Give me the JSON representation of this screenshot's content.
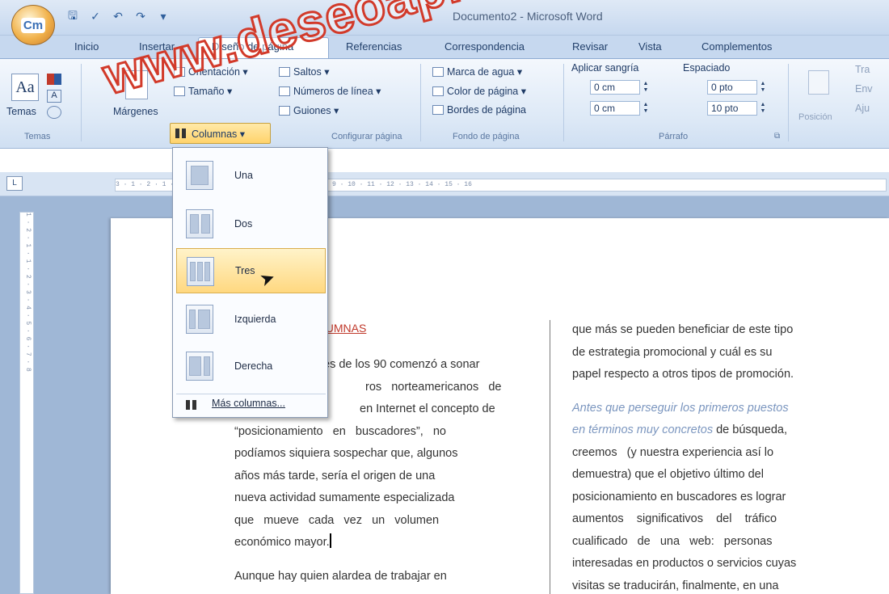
{
  "window": {
    "title": "Documento2 - Microsoft Word"
  },
  "office_button": {
    "label": "Cm"
  },
  "quick_access": [
    "save-icon",
    "spelling-icon",
    "undo-icon",
    "redo-icon",
    "customize-icon"
  ],
  "tabs": [
    "Inicio",
    "Insertar",
    "Diseño de página",
    "Referencias",
    "Correspondencia",
    "Revisar",
    "Vista",
    "Complementos"
  ],
  "active_tab": "Diseño de página",
  "ribbon": {
    "temas": {
      "button": "Temas",
      "group": "Temas"
    },
    "config": {
      "margenes": "Márgenes",
      "orientacion": "Orientación ▾",
      "tamano": "Tamaño ▾",
      "columnas": "Columnas ▾",
      "saltos": "Saltos ▾",
      "numeros": "Números de línea ▾",
      "guiones": "Guiones ▾",
      "group": "Configurar página"
    },
    "fondo": {
      "marca": "Marca de agua ▾",
      "color": "Color de página ▾",
      "bordes": "Bordes de página",
      "group": "Fondo de página"
    },
    "parrafo": {
      "aplicar": "Aplicar sangría",
      "espaciado": "Espaciado",
      "sangria1": "0 cm",
      "sangria2": "0 cm",
      "esp1": "0 pto",
      "esp2": "10 pto",
      "group": "Párrafo"
    },
    "organizar": {
      "posicion": "Posición",
      "tra": "Tra",
      "env": "Env",
      "aju": "Aju"
    }
  },
  "ruler": {
    "h": "3 · 1 · 2 · 1 · 1 · ∣ · 1 · 2 · 3 · 4 · 5 · 6 · 7 · 8 · 9 · 10 · 11 · 12 · 13 · 14 · 15 · 16",
    "v": "1 · 2 · 1 · 1 · 2 · 3 · 4 · 5 · 6 · 7 · 8"
  },
  "menu": {
    "items": [
      "Una",
      "Dos",
      "Tres",
      "Izquierda",
      "Derecha"
    ],
    "highlighted": "Tres",
    "more": "Más columnas..."
  },
  "document": {
    "heading_tail": "LUMNAS",
    "left": [
      "es de los 90 comenzó a sonar",
      "ros   norteamericanos   de",
      "en Internet el concepto de",
      "“posicionamiento   en   buscadores”,   no",
      "podíamos siquiera sospechar que, algunos",
      "años más tarde, sería el origen de una",
      "nueva actividad sumamente especializada",
      "que   mueve   cada   vez   un   volumen",
      "económico mayor.",
      "Aunque hay quien alardea de trabajar en"
    ],
    "right_plain": [
      "que más se pueden beneficiar de este tipo",
      "de estrategia promocional y cuál es su",
      "papel respecto a otros tipos de promoción."
    ],
    "right_emph1": "Antes que perseguir los primeros puestos",
    "right_emph2": "en términos muy concretos",
    "right_emph2_rest": " de búsqueda,",
    "right_rest": [
      "creemos   (y nuestra experiencia así lo",
      "demuestra) que el objetivo último del",
      "posicionamiento en buscadores es lograr",
      "aumentos    significativos    del    tráfico",
      "cualificado   de   una   web:   personas",
      "interesadas en productos o servicios cuyas",
      "visitas se traducirán, finalmente, en una"
    ]
  },
  "watermark": "www.deseoaprender.com"
}
